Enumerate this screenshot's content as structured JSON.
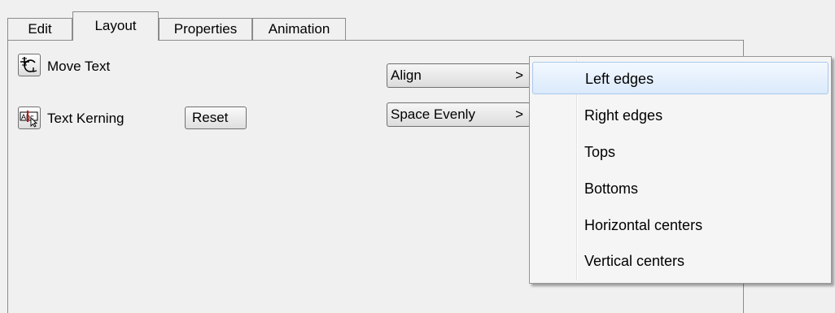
{
  "tabs": {
    "edit": "Edit",
    "layout": "Layout",
    "properties": "Properties",
    "animation": "Animation",
    "active": "Layout"
  },
  "tools": {
    "move_text_label": "Move Text",
    "move_text_icon": "move-text-icon",
    "text_kerning_label": "Text Kerning",
    "text_kerning_icon": "text-kerning-icon",
    "reset_label": "Reset"
  },
  "menus": {
    "align_label": "Align",
    "align_arrow": ">",
    "space_evenly_label": "Space Evenly",
    "space_evenly_arrow": ">"
  },
  "align_submenu": {
    "highlighted": "Left edges",
    "items": [
      "Left edges",
      "Right edges",
      "Tops",
      "Bottoms",
      "Horizontal centers",
      "Vertical centers"
    ]
  },
  "colors": {
    "highlight_border": "#a8c8ee",
    "kerning_red": "#cc0000"
  }
}
